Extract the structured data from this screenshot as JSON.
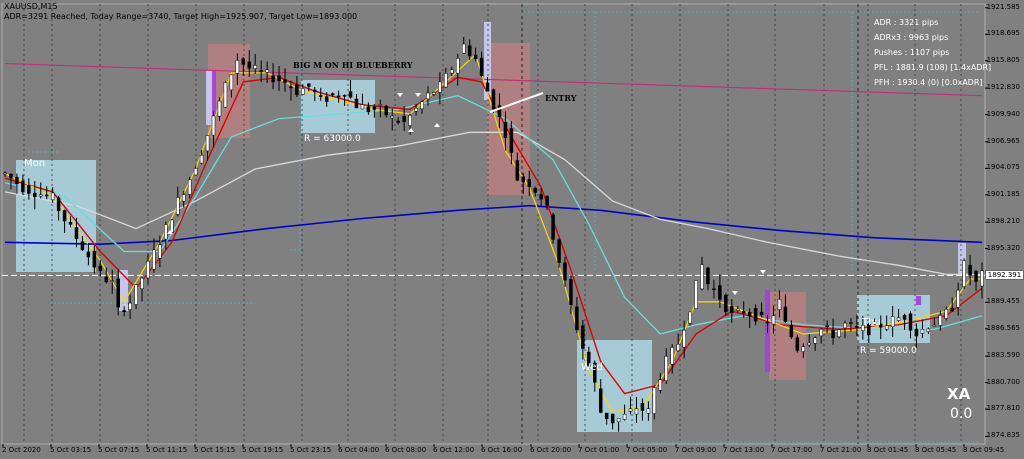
{
  "header": {
    "symbol": "XAUUSD,M15",
    "status": "ADR=3291 Reached, Today Range=3740, Target High=1925.907, Target Low=1893.000"
  },
  "info_panel": [
    "ADR : 3321 pips",
    "ADRx3 : 9963 pips",
    "Pushes : 1107 pips",
    "PFL : 1881.9 (108) [1.4xADR]",
    "PFH : 1930.4 (0) [0.0xADR]"
  ],
  "brand": {
    "name": "XA",
    "value": "0.0"
  },
  "current_price_label": "1892.391",
  "annotations": {
    "blueberry": "BIG M ON HI BLUEBERRY",
    "entry": "ENTRY",
    "range_1": "R = 63000.0",
    "range_2": "R = 59000.0",
    "day_mon": "Mon",
    "day_wed": "Wed",
    "day_thu": "Thu"
  },
  "colors": {
    "background": "#808080",
    "ema_fast": "#ffd700",
    "ema_mid": "#e00000",
    "ma_cyan": "#66dddd",
    "ma_white": "#d9d9d9",
    "ma_blue": "#0000cc",
    "trend_line": "#c0307a",
    "box_cyan": "#add8e6",
    "box_pink": "#c08080"
  },
  "chart_data": {
    "type": "candlestick",
    "symbol": "XAUUSD",
    "timeframe": "M15",
    "ylim": [
      1874.0,
      1922.0
    ],
    "y_ticks": [
      1921.585,
      1918.695,
      1915.805,
      1912.83,
      1909.94,
      1906.965,
      1904.075,
      1901.185,
      1898.21,
      1895.32,
      1892.43,
      1889.455,
      1886.565,
      1883.59,
      1880.7,
      1877.81,
      1874.835
    ],
    "x_ticks": [
      "2 Oct 2020",
      "5 Oct 03:15",
      "5 Oct 07:15",
      "5 Oct 11:15",
      "5 Oct 15:15",
      "5 Oct 19:15",
      "5 Oct 23:15",
      "6 Oct 04:00",
      "6 Oct 08:00",
      "6 Oct 12:00",
      "6 Oct 16:00",
      "6 Oct 20:00",
      "7 Oct 01:00",
      "7 Oct 05:00",
      "7 Oct 09:00",
      "7 Oct 13:00",
      "7 Oct 17:00",
      "7 Oct 21:00",
      "8 Oct 01:45",
      "8 Oct 05:45",
      "8 Oct 09:45"
    ],
    "current_price": 1892.391,
    "price_path": [
      [
        0,
        1903.5
      ],
      [
        3,
        1902.0
      ],
      [
        5,
        1901.5
      ],
      [
        8,
        1900.8
      ],
      [
        10,
        1898.5
      ],
      [
        12,
        1896.5
      ],
      [
        14,
        1894.5
      ],
      [
        16,
        1892.5
      ],
      [
        18,
        1891.5
      ],
      [
        19,
        1888.5
      ],
      [
        21,
        1889.5
      ],
      [
        24,
        1893.5
      ],
      [
        27,
        1897.5
      ],
      [
        29,
        1900.5
      ],
      [
        31,
        1903.0
      ],
      [
        33,
        1906.0
      ],
      [
        35,
        1909.5
      ],
      [
        37,
        1913.0
      ],
      [
        39,
        1916.0
      ],
      [
        41,
        1915.0
      ],
      [
        43,
        1914.5
      ],
      [
        45,
        1914.0
      ],
      [
        47,
        1913.5
      ],
      [
        49,
        1912.5
      ],
      [
        51,
        1913.0
      ],
      [
        53,
        1911.5
      ],
      [
        55,
        1912.0
      ],
      [
        57,
        1912.5
      ],
      [
        59,
        1911.0
      ],
      [
        61,
        1910.5
      ],
      [
        63,
        1910.5
      ],
      [
        65,
        1909.5
      ],
      [
        67,
        1909.0
      ],
      [
        69,
        1910.5
      ],
      [
        71,
        1912.0
      ],
      [
        73,
        1913.0
      ],
      [
        75,
        1915.0
      ],
      [
        77,
        1917.5
      ],
      [
        79,
        1916.0
      ],
      [
        80,
        1914.0
      ],
      [
        82,
        1911.0
      ],
      [
        84,
        1908.0
      ],
      [
        86,
        1903.0
      ],
      [
        88,
        1902.5
      ],
      [
        90,
        1901.0
      ],
      [
        91,
        1899.5
      ],
      [
        93,
        1894.0
      ],
      [
        95,
        1889.0
      ],
      [
        97,
        1884.5
      ],
      [
        99,
        1880.5
      ],
      [
        100,
        1877.5
      ],
      [
        102,
        1876.5
      ],
      [
        104,
        1877.0
      ],
      [
        106,
        1878.0
      ],
      [
        108,
        1877.5
      ],
      [
        109,
        1880.0
      ],
      [
        111,
        1883.0
      ],
      [
        113,
        1885.0
      ],
      [
        115,
        1889.0
      ],
      [
        117,
        1893.5
      ],
      [
        118,
        1891.5
      ],
      [
        120,
        1890.0
      ],
      [
        122,
        1888.0
      ],
      [
        124,
        1888.5
      ],
      [
        126,
        1888.0
      ],
      [
        128,
        1887.0
      ],
      [
        130,
        1889.5
      ],
      [
        131,
        1887.0
      ],
      [
        133,
        1884.5
      ],
      [
        135,
        1885.5
      ],
      [
        137,
        1886.5
      ],
      [
        139,
        1886.0
      ],
      [
        141,
        1887.0
      ],
      [
        143,
        1886.5
      ],
      [
        145,
        1886.5
      ],
      [
        147,
        1887.0
      ],
      [
        149,
        1887.5
      ],
      [
        151,
        1888.0
      ],
      [
        153,
        1886.0
      ],
      [
        155,
        1887.0
      ],
      [
        157,
        1887.5
      ],
      [
        159,
        1889.0
      ],
      [
        161,
        1893.5
      ],
      [
        163,
        1891.5
      ],
      [
        164,
        1892.4
      ]
    ],
    "moving_averages": {
      "yellow": [
        [
          0,
          1903.5
        ],
        [
          8,
          1901.0
        ],
        [
          16,
          1894.0
        ],
        [
          20,
          1889.5
        ],
        [
          26,
          1896.0
        ],
        [
          32,
          1904.0
        ],
        [
          38,
          1914.5
        ],
        [
          44,
          1914.5
        ],
        [
          50,
          1912.5
        ],
        [
          56,
          1911.5
        ],
        [
          62,
          1910.5
        ],
        [
          68,
          1910.0
        ],
        [
          74,
          1913.5
        ],
        [
          79,
          1916.5
        ],
        [
          84,
          1906.0
        ],
        [
          88,
          1902.0
        ],
        [
          93,
          1893.5
        ],
        [
          98,
          1882.0
        ],
        [
          102,
          1877.5
        ],
        [
          107,
          1878.0
        ],
        [
          112,
          1883.0
        ],
        [
          116,
          1889.5
        ],
        [
          120,
          1889.5
        ],
        [
          128,
          1887.5
        ],
        [
          134,
          1886.0
        ],
        [
          144,
          1886.5
        ],
        [
          152,
          1887.5
        ],
        [
          158,
          1888.5
        ],
        [
          162,
          1892.0
        ],
        [
          164,
          1892.0
        ]
      ],
      "red": [
        [
          0,
          1903.0
        ],
        [
          8,
          1901.5
        ],
        [
          16,
          1895.0
        ],
        [
          22,
          1891.0
        ],
        [
          28,
          1896.0
        ],
        [
          34,
          1905.0
        ],
        [
          40,
          1913.5
        ],
        [
          46,
          1914.0
        ],
        [
          52,
          1912.5
        ],
        [
          60,
          1911.0
        ],
        [
          68,
          1910.5
        ],
        [
          76,
          1914.0
        ],
        [
          80,
          1913.5
        ],
        [
          85,
          1907.5
        ],
        [
          90,
          1902.0
        ],
        [
          95,
          1893.0
        ],
        [
          100,
          1883.0
        ],
        [
          104,
          1879.5
        ],
        [
          110,
          1880.5
        ],
        [
          116,
          1886.0
        ],
        [
          122,
          1888.5
        ],
        [
          130,
          1887.0
        ],
        [
          140,
          1886.5
        ],
        [
          150,
          1887.0
        ],
        [
          158,
          1888.0
        ],
        [
          164,
          1891.0
        ]
      ],
      "cyan": [
        [
          0,
          1902.5
        ],
        [
          10,
          1901.0
        ],
        [
          20,
          1895.0
        ],
        [
          26,
          1895.0
        ],
        [
          32,
          1901.0
        ],
        [
          38,
          1907.5
        ],
        [
          46,
          1909.5
        ],
        [
          56,
          1910.0
        ],
        [
          66,
          1910.5
        ],
        [
          76,
          1912.0
        ],
        [
          84,
          1909.5
        ],
        [
          92,
          1905.0
        ],
        [
          98,
          1898.0
        ],
        [
          104,
          1890.0
        ],
        [
          110,
          1886.0
        ],
        [
          116,
          1887.0
        ],
        [
          124,
          1888.0
        ],
        [
          134,
          1887.0
        ],
        [
          146,
          1886.5
        ],
        [
          156,
          1886.5
        ],
        [
          164,
          1888.0
        ]
      ],
      "white": [
        [
          0,
          1901.5
        ],
        [
          12,
          1900.0
        ],
        [
          22,
          1897.5
        ],
        [
          32,
          1900.5
        ],
        [
          42,
          1904.0
        ],
        [
          54,
          1905.5
        ],
        [
          66,
          1906.5
        ],
        [
          78,
          1908.0
        ],
        [
          86,
          1908.0
        ],
        [
          94,
          1905.0
        ],
        [
          102,
          1900.5
        ],
        [
          110,
          1898.5
        ],
        [
          118,
          1897.5
        ],
        [
          128,
          1896.0
        ],
        [
          140,
          1894.5
        ],
        [
          150,
          1893.5
        ],
        [
          158,
          1892.5
        ],
        [
          164,
          1892.5
        ]
      ],
      "blue": [
        [
          0,
          1896.0
        ],
        [
          16,
          1895.8
        ],
        [
          28,
          1896.2
        ],
        [
          44,
          1897.5
        ],
        [
          60,
          1898.6
        ],
        [
          76,
          1899.5
        ],
        [
          88,
          1900.0
        ],
        [
          100,
          1899.5
        ],
        [
          116,
          1898.2
        ],
        [
          130,
          1897.3
        ],
        [
          146,
          1896.5
        ],
        [
          164,
          1896.0
        ]
      ]
    },
    "trend_line": {
      "from": [
        0,
        1915.5
      ],
      "to": [
        164,
        1912.0
      ]
    }
  }
}
